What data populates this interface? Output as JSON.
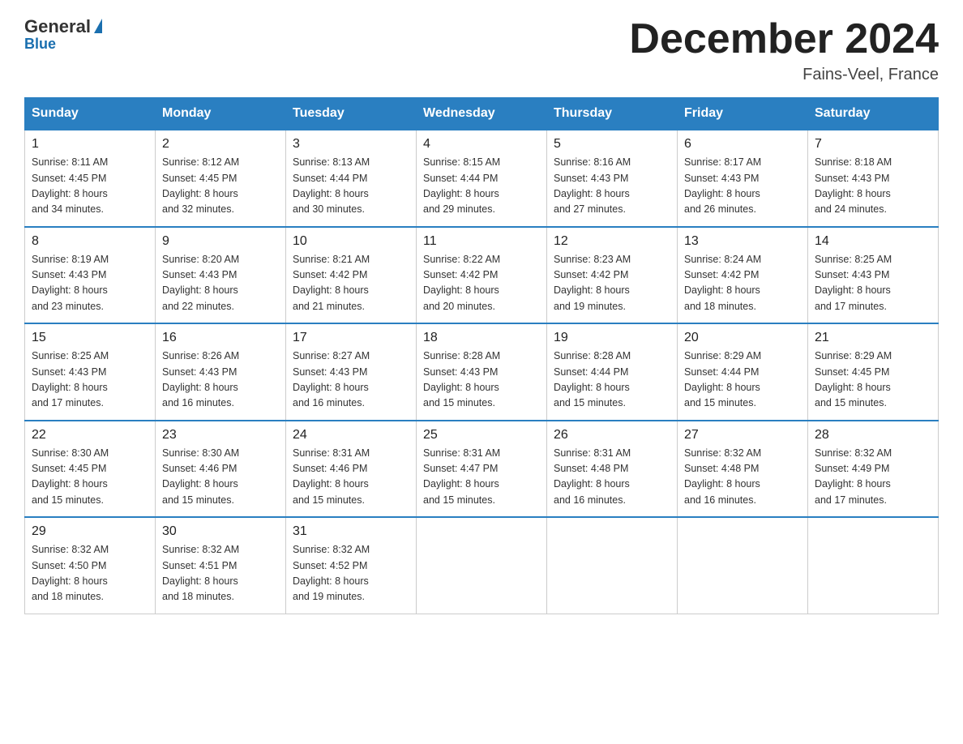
{
  "header": {
    "logo_general": "General",
    "logo_blue": "Blue",
    "month_title": "December 2024",
    "location": "Fains-Veel, France"
  },
  "weekdays": [
    "Sunday",
    "Monday",
    "Tuesday",
    "Wednesday",
    "Thursday",
    "Friday",
    "Saturday"
  ],
  "weeks": [
    [
      {
        "day": "1",
        "sunrise": "8:11 AM",
        "sunset": "4:45 PM",
        "daylight": "8 hours and 34 minutes."
      },
      {
        "day": "2",
        "sunrise": "8:12 AM",
        "sunset": "4:45 PM",
        "daylight": "8 hours and 32 minutes."
      },
      {
        "day": "3",
        "sunrise": "8:13 AM",
        "sunset": "4:44 PM",
        "daylight": "8 hours and 30 minutes."
      },
      {
        "day": "4",
        "sunrise": "8:15 AM",
        "sunset": "4:44 PM",
        "daylight": "8 hours and 29 minutes."
      },
      {
        "day": "5",
        "sunrise": "8:16 AM",
        "sunset": "4:43 PM",
        "daylight": "8 hours and 27 minutes."
      },
      {
        "day": "6",
        "sunrise": "8:17 AM",
        "sunset": "4:43 PM",
        "daylight": "8 hours and 26 minutes."
      },
      {
        "day": "7",
        "sunrise": "8:18 AM",
        "sunset": "4:43 PM",
        "daylight": "8 hours and 24 minutes."
      }
    ],
    [
      {
        "day": "8",
        "sunrise": "8:19 AM",
        "sunset": "4:43 PM",
        "daylight": "8 hours and 23 minutes."
      },
      {
        "day": "9",
        "sunrise": "8:20 AM",
        "sunset": "4:43 PM",
        "daylight": "8 hours and 22 minutes."
      },
      {
        "day": "10",
        "sunrise": "8:21 AM",
        "sunset": "4:42 PM",
        "daylight": "8 hours and 21 minutes."
      },
      {
        "day": "11",
        "sunrise": "8:22 AM",
        "sunset": "4:42 PM",
        "daylight": "8 hours and 20 minutes."
      },
      {
        "day": "12",
        "sunrise": "8:23 AM",
        "sunset": "4:42 PM",
        "daylight": "8 hours and 19 minutes."
      },
      {
        "day": "13",
        "sunrise": "8:24 AM",
        "sunset": "4:42 PM",
        "daylight": "8 hours and 18 minutes."
      },
      {
        "day": "14",
        "sunrise": "8:25 AM",
        "sunset": "4:43 PM",
        "daylight": "8 hours and 17 minutes."
      }
    ],
    [
      {
        "day": "15",
        "sunrise": "8:25 AM",
        "sunset": "4:43 PM",
        "daylight": "8 hours and 17 minutes."
      },
      {
        "day": "16",
        "sunrise": "8:26 AM",
        "sunset": "4:43 PM",
        "daylight": "8 hours and 16 minutes."
      },
      {
        "day": "17",
        "sunrise": "8:27 AM",
        "sunset": "4:43 PM",
        "daylight": "8 hours and 16 minutes."
      },
      {
        "day": "18",
        "sunrise": "8:28 AM",
        "sunset": "4:43 PM",
        "daylight": "8 hours and 15 minutes."
      },
      {
        "day": "19",
        "sunrise": "8:28 AM",
        "sunset": "4:44 PM",
        "daylight": "8 hours and 15 minutes."
      },
      {
        "day": "20",
        "sunrise": "8:29 AM",
        "sunset": "4:44 PM",
        "daylight": "8 hours and 15 minutes."
      },
      {
        "day": "21",
        "sunrise": "8:29 AM",
        "sunset": "4:45 PM",
        "daylight": "8 hours and 15 minutes."
      }
    ],
    [
      {
        "day": "22",
        "sunrise": "8:30 AM",
        "sunset": "4:45 PM",
        "daylight": "8 hours and 15 minutes."
      },
      {
        "day": "23",
        "sunrise": "8:30 AM",
        "sunset": "4:46 PM",
        "daylight": "8 hours and 15 minutes."
      },
      {
        "day": "24",
        "sunrise": "8:31 AM",
        "sunset": "4:46 PM",
        "daylight": "8 hours and 15 minutes."
      },
      {
        "day": "25",
        "sunrise": "8:31 AM",
        "sunset": "4:47 PM",
        "daylight": "8 hours and 15 minutes."
      },
      {
        "day": "26",
        "sunrise": "8:31 AM",
        "sunset": "4:48 PM",
        "daylight": "8 hours and 16 minutes."
      },
      {
        "day": "27",
        "sunrise": "8:32 AM",
        "sunset": "4:48 PM",
        "daylight": "8 hours and 16 minutes."
      },
      {
        "day": "28",
        "sunrise": "8:32 AM",
        "sunset": "4:49 PM",
        "daylight": "8 hours and 17 minutes."
      }
    ],
    [
      {
        "day": "29",
        "sunrise": "8:32 AM",
        "sunset": "4:50 PM",
        "daylight": "8 hours and 18 minutes."
      },
      {
        "day": "30",
        "sunrise": "8:32 AM",
        "sunset": "4:51 PM",
        "daylight": "8 hours and 18 minutes."
      },
      {
        "day": "31",
        "sunrise": "8:32 AM",
        "sunset": "4:52 PM",
        "daylight": "8 hours and 19 minutes."
      },
      null,
      null,
      null,
      null
    ]
  ]
}
